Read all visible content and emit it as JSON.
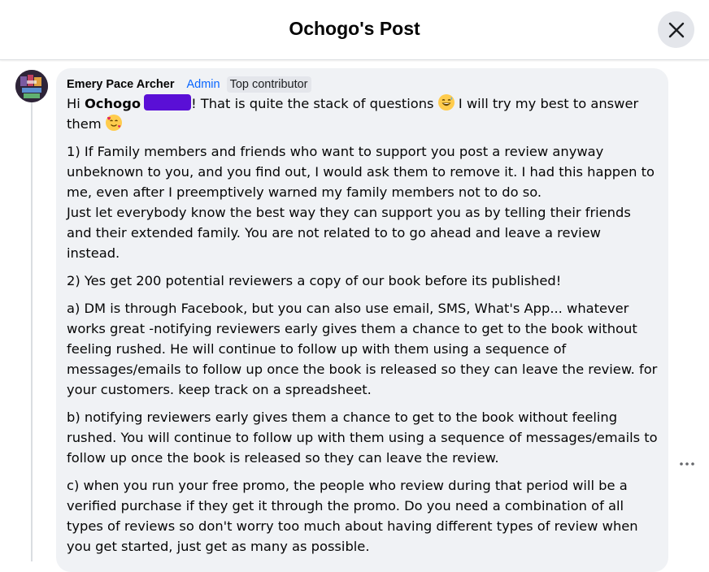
{
  "header": {
    "title": "Ochogo's Post"
  },
  "comment": {
    "author": "Emery Pace Archer",
    "role": "Admin",
    "badge": "Top contributor",
    "greeting_prefix": "Hi",
    "mention": "Ochogo",
    "greeting_rest": "! That is quite the stack of questions",
    "greeting_after": "I will try my best to answer",
    "greeting_line2": "them",
    "paragraphs": {
      "p1": "1) If Family members and friends who want to support you post a review anyway unbeknown to you, and you find out, I would ask them to remove it. I had this happen to me, even after I preemptively warned my family members not to do so.",
      "p1b": "Just let everybody know the best way they can support you as by telling their friends and their extended family. You are not related to to go ahead and leave a review instead.",
      "p2": "2) Yes get 200 potential reviewers a copy of our book before its published!",
      "pa": "a) DM is through Facebook, but you can also use email, SMS, What's App... whatever works great -notifying reviewers early gives them a chance to get to the book without feeling rushed. He will continue to follow up with them using a sequence of messages/emails to follow up once the book is released so they can leave the review. for your customers. keep track on a spreadsheet.",
      "pb": "b) notifying reviewers early gives them a chance to get to the book without feeling rushed. You will continue to follow up with them using a sequence of messages/emails to follow up once the book is released so they can leave the review.",
      "pc": "c) when you run your free promo, the people who review during that period will be a verified purchase if they get it through the promo. Do you need a combination of all types of reviews so don't worry too much about having different types of review when you get started, just get as many as possible."
    }
  },
  "icons": {
    "close": "close-icon",
    "more": "more-horizontal-icon",
    "laugh": "grinning-sweat-emoji",
    "love": "smiling-hearts-emoji"
  },
  "colors": {
    "admin_link": "#0866ff",
    "bubble_bg": "#f0f2f5",
    "redaction": "#5a0fd6"
  }
}
